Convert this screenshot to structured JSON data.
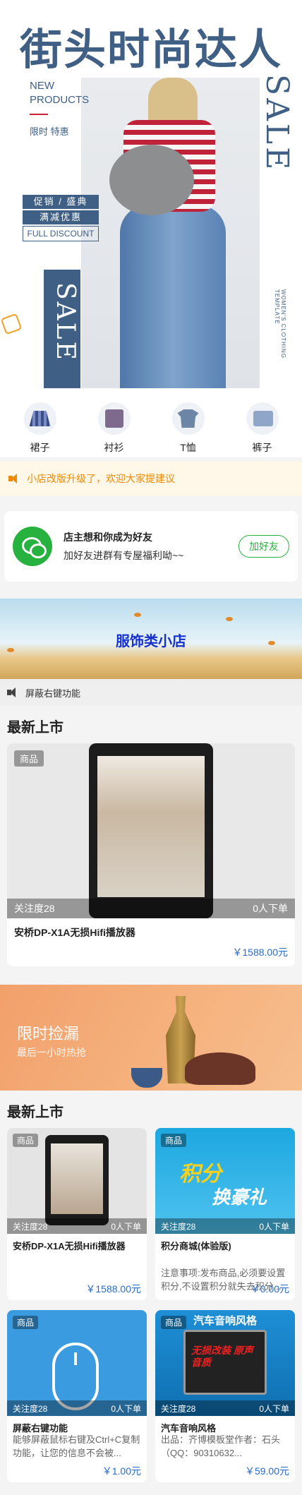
{
  "hero": {
    "title": "街头时尚达人",
    "new_products": "NEW\nPRODUCTS",
    "limited": "限时 特惠",
    "sale_right": "SALE",
    "sale_left": "SALE",
    "promo_line1": "促销 / 盛典",
    "promo_line2": "满减优惠",
    "promo_line3": "FULL DISCOUNT",
    "vertical_small": "WOMEN'S CLOTHING TEMPLATE"
  },
  "categories": [
    {
      "label": "裙子",
      "icon": "skirt-icon"
    },
    {
      "label": "衬衫",
      "icon": "shirt-icon"
    },
    {
      "label": "T恤",
      "icon": "tshirt-icon"
    },
    {
      "label": "裤子",
      "icon": "pants-icon"
    }
  ],
  "notice": {
    "text": "小店改版升级了，欢迎大家提建议"
  },
  "friend": {
    "title": "店主想和你成为好友",
    "subtitle": "加好友进群有专屋福利呦~~",
    "button": "加好友"
  },
  "shop_banner": {
    "title": "服饰类小店"
  },
  "disable_row": {
    "text": "屏蔽右键功能"
  },
  "section1": {
    "title": "最新上市"
  },
  "featured": {
    "tag": "商品",
    "followers": "关注度28",
    "orders": "0人下单",
    "name": "安桥DP-X1A无损Hifi播放器",
    "price": "￥1588.00元"
  },
  "limited_banner": {
    "title": "限时捡漏",
    "subtitle": "最后一小时热抢"
  },
  "section2": {
    "title": "最新上市"
  },
  "products": [
    {
      "tag": "商品",
      "followers": "关注度28",
      "orders": "0人下单",
      "name": "安桥DP-X1A无损Hifi播放器",
      "desc": "",
      "price": "￥1588.00元"
    },
    {
      "tag": "商品",
      "followers": "关注度28",
      "orders": "0人下单",
      "name": "积分商城(体验版)",
      "desc": "注意事项:发布商品,必须要设置积分,不设置积分就失去积分...",
      "price": "￥0.00元",
      "image_text_1": "积分",
      "image_text_2": "换豪礼"
    },
    {
      "tag": "商品",
      "followers": "关注度28",
      "orders": "0人下单",
      "name": "屏蔽右键功能",
      "desc": "能够屏蔽鼠标右键及Ctrl+C复制功能，让您的信息不会被...",
      "price": "￥1.00元"
    },
    {
      "tag": "商品",
      "followers": "关注度28",
      "orders": "0人下单",
      "name": "汽车音响风格",
      "desc": "出品：齐博模板堂作者：石头（QQ：90310632...",
      "price": "￥59.00元",
      "image_text_1": "汽车音响风格",
      "image_text_2": "无损改装 原声音质"
    }
  ]
}
